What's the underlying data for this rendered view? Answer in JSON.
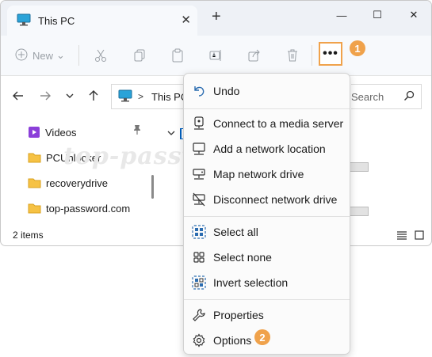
{
  "window": {
    "tab_title": "This PC",
    "new_tab": "+",
    "minimize": "—",
    "maximize": "☐",
    "close": "✕",
    "tab_close": "✕"
  },
  "toolbar": {
    "new_label": "New",
    "new_caret": "⌄",
    "more_label": "•••",
    "callout_more": "1"
  },
  "address": {
    "separator": ">",
    "location": "This PC",
    "search_placeholder": "Search"
  },
  "sidebar": {
    "items": [
      {
        "label": "Videos",
        "icon": "videos-folder-icon",
        "pinned": true
      },
      {
        "label": "PCUnlocker",
        "icon": "folder-icon"
      },
      {
        "label": "recoverydrive",
        "icon": "folder-icon"
      },
      {
        "label": "top-password.com",
        "icon": "folder-icon"
      }
    ]
  },
  "status": {
    "item_count": "2 items"
  },
  "watermark": "top-password.com",
  "menu": {
    "items": [
      {
        "label": "Undo",
        "icon": "undo-icon"
      },
      {
        "label": "Connect to a media server",
        "icon": "media-server-icon"
      },
      {
        "label": "Add a network location",
        "icon": "network-location-icon"
      },
      {
        "label": "Map network drive",
        "icon": "map-drive-icon"
      },
      {
        "label": "Disconnect network drive",
        "icon": "disconnect-drive-icon"
      },
      {
        "label": "Select all",
        "icon": "select-all-icon"
      },
      {
        "label": "Select none",
        "icon": "select-none-icon"
      },
      {
        "label": "Invert selection",
        "icon": "invert-selection-icon"
      },
      {
        "label": "Properties",
        "icon": "wrench-icon"
      },
      {
        "label": "Options",
        "icon": "gear-icon"
      }
    ],
    "callout_options": "2"
  },
  "colors": {
    "accent_callout": "#f0a24b",
    "title_bar": "#eef1f6",
    "menu_bg": "#fbfbfb"
  }
}
